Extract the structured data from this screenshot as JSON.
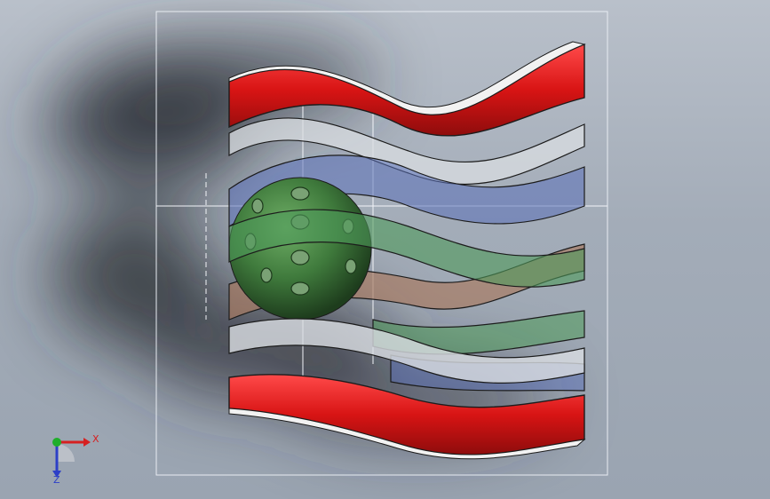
{
  "viewport": {
    "background_top": "#b9c0ca",
    "background_bottom": "#9aa4b1",
    "bounding_box_color": "#e8ecf2",
    "sketch_line_color": "#f2f4f8"
  },
  "model": {
    "band_colors": [
      "#d81414",
      "#d9dde2",
      "#5a6fb8",
      "#4f9a5a",
      "#a87c64",
      "#d9dde2",
      "#d81414"
    ],
    "sphere_color": "#3f7a3c",
    "sphere_holes": 9
  },
  "triad": {
    "x_label": "X",
    "z_label": "Z",
    "x_color": "#d62020",
    "y_color": "#1fae2a",
    "z_color": "#2d3fc7"
  },
  "icons": [
    "coordinate-triad-icon"
  ]
}
